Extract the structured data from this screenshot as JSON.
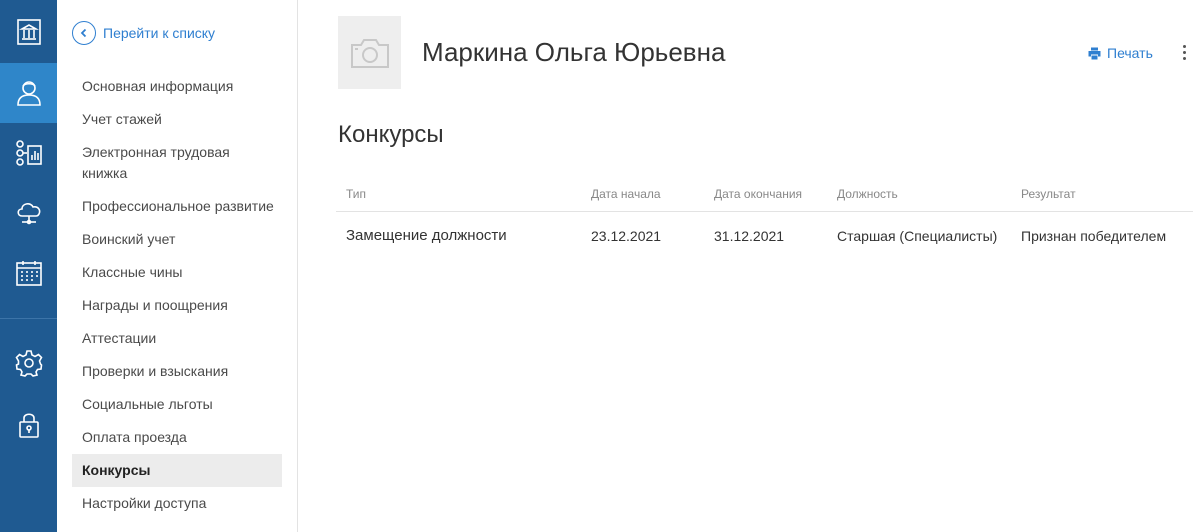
{
  "rail": {
    "items": [
      {
        "icon": "institution-icon"
      },
      {
        "icon": "user-icon",
        "active": true
      },
      {
        "icon": "org-chart-icon"
      },
      {
        "icon": "cloud-network-icon"
      },
      {
        "icon": "calendar-icon"
      },
      {
        "icon": "gear-icon"
      },
      {
        "icon": "lock-icon"
      }
    ]
  },
  "subnav": {
    "back_label": "Перейти к списку",
    "items": [
      {
        "label": "Основная информация"
      },
      {
        "label": "Учет стажей"
      },
      {
        "label": "Электронная трудовая книжка"
      },
      {
        "label": "Профессиональное развитие"
      },
      {
        "label": "Воинский учет"
      },
      {
        "label": "Классные чины"
      },
      {
        "label": "Награды и поощрения"
      },
      {
        "label": "Аттестации"
      },
      {
        "label": "Проверки и взыскания"
      },
      {
        "label": "Социальные льготы"
      },
      {
        "label": "Оплата проезда"
      },
      {
        "label": "Конкурсы",
        "active": true
      },
      {
        "label": "Настройки доступа"
      }
    ]
  },
  "header": {
    "person_name": "Маркина Ольга Юрьевна",
    "print_label": "Печать"
  },
  "section": {
    "title": "Конкурсы"
  },
  "table": {
    "columns": [
      "Тип",
      "Дата начала",
      "Дата окончания",
      "Должность",
      "Результат"
    ],
    "rows": [
      [
        "Замещение должности",
        "23.12.2021",
        "31.12.2021",
        "Старшая (Специалисты)",
        "Признан победителем"
      ]
    ]
  },
  "colors": {
    "rail_bg": "#1f5a91",
    "rail_active": "#2f86c9",
    "accent": "#2f7fd0"
  }
}
